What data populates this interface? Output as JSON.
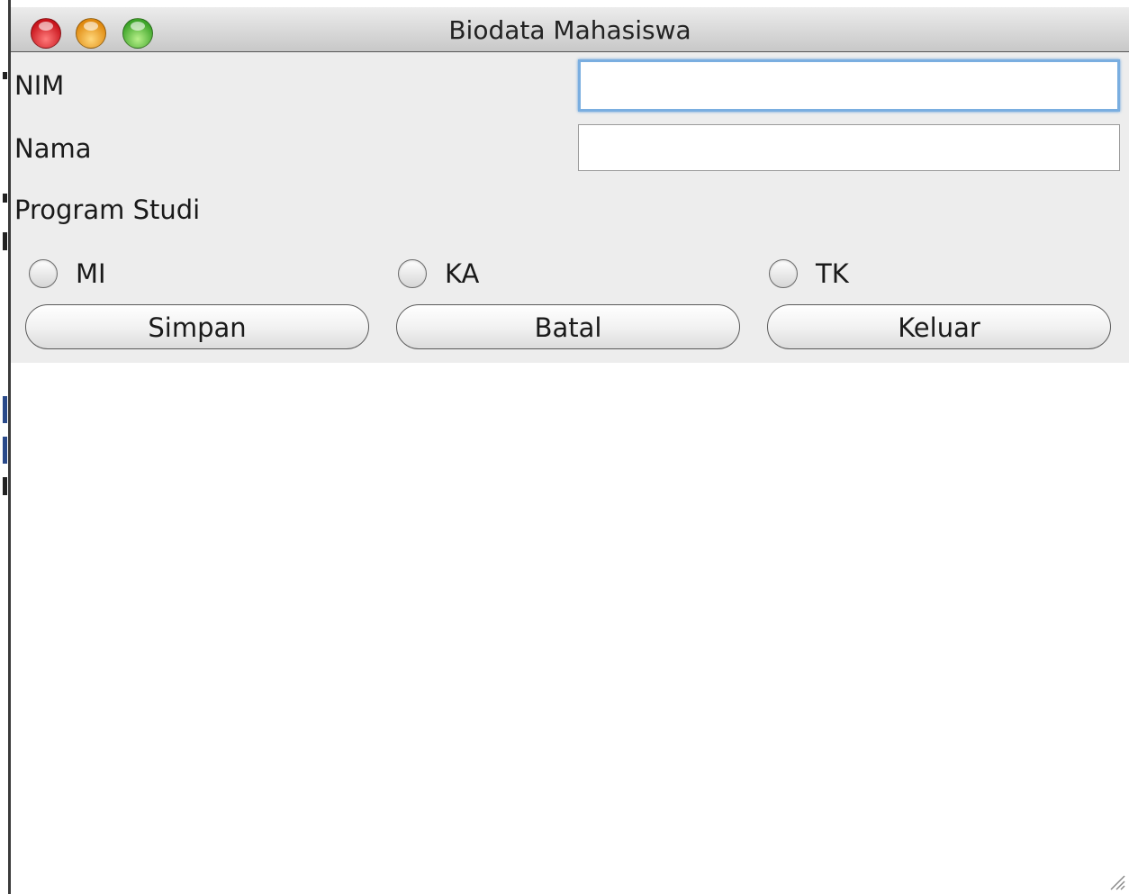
{
  "window": {
    "title": "Biodata Mahasiswa"
  },
  "form": {
    "nim_label": "NIM",
    "nim_value": "",
    "nama_label": "Nama",
    "nama_value": "",
    "program_label": "Program Studi",
    "program_options": [
      "MI",
      "KA",
      "TK"
    ],
    "program_selected": null
  },
  "buttons": {
    "simpan": "Simpan",
    "batal": "Batal",
    "keluar": "Keluar"
  },
  "colors": {
    "focus_ring": "#7aaee0",
    "panel_bg": "#ededed",
    "close": "#c8141c",
    "minimize": "#e08a10",
    "zoom": "#3ea52a"
  },
  "icons": [
    "close-icon",
    "minimize-icon",
    "zoom-icon",
    "resize-grip-icon"
  ]
}
